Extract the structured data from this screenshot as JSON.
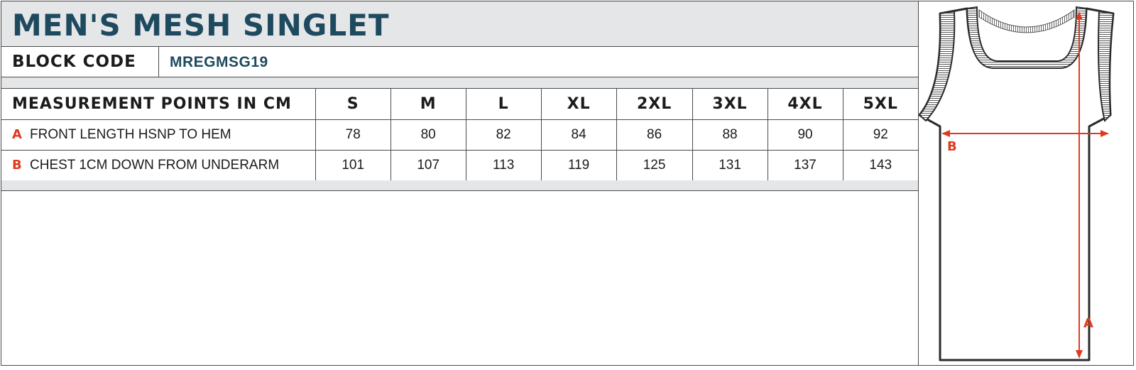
{
  "title": "MEN'S MESH SINGLET",
  "block": {
    "label": "BLOCK CODE",
    "code": "MREGMSG19"
  },
  "table": {
    "header_label": "MEASUREMENT POINTS IN CM",
    "sizes": [
      "S",
      "M",
      "L",
      "XL",
      "2XL",
      "3XL",
      "4XL",
      "5XL"
    ],
    "rows": [
      {
        "letter": "A",
        "description": "FRONT LENGTH HSNP TO HEM",
        "values": [
          "78",
          "80",
          "82",
          "84",
          "86",
          "88",
          "90",
          "92"
        ]
      },
      {
        "letter": "B",
        "description": "CHEST 1CM DOWN FROM UNDERARM",
        "values": [
          "101",
          "107",
          "113",
          "119",
          "125",
          "131",
          "137",
          "143"
        ]
      }
    ]
  },
  "diagram": {
    "labels": {
      "chest": "B",
      "length": "A"
    },
    "colors": {
      "measure": "#e03a1e",
      "outline": "#2b2b2b"
    }
  }
}
